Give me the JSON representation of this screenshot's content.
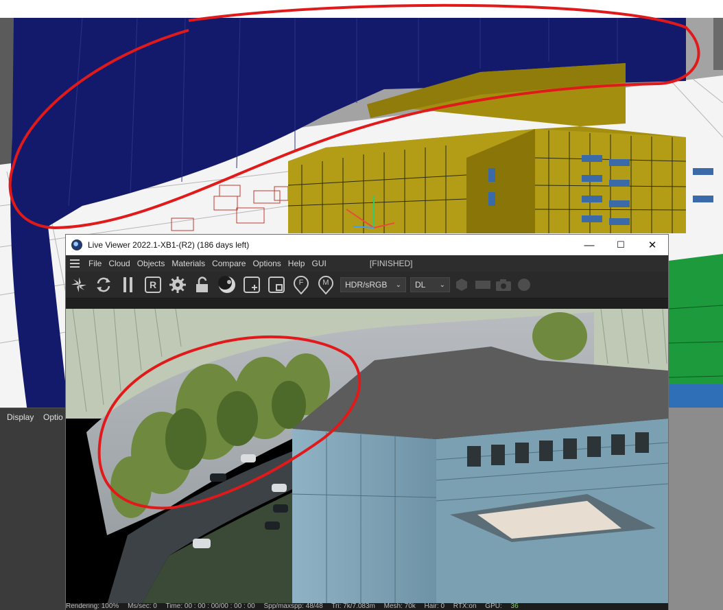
{
  "background_app": {
    "bottom_panel_tabs": [
      "Display",
      "Optio"
    ]
  },
  "live_viewer": {
    "title": "Live Viewer 2022.1-XB1-(R2) (186 days left)",
    "window_controls": {
      "minimize": "—",
      "maximize": "☐",
      "close": "✕"
    },
    "menu": [
      "File",
      "Cloud",
      "Objects",
      "Materials",
      "Compare",
      "Options",
      "Help",
      "GUI"
    ],
    "render_status": "[FINISHED]",
    "toolbar": {
      "icons": [
        "send-scene-icon",
        "restart-icon",
        "pause-icon",
        "region-render-icon",
        "settings-gear-icon",
        "lock-icon",
        "material-ball-icon",
        "add-region-icon",
        "clear-region-icon",
        "focus-pick-icon",
        "material-pick-icon"
      ],
      "letter_r": "R",
      "letter_f": "F",
      "letter_m": "M",
      "colorspace_select": "HDR/sRGB",
      "kernel_select": "DL"
    },
    "statusbar": {
      "rendering": "Rendering: 100%",
      "mssec": "Ms/sec: 0",
      "time": "Time: 00 : 00 : 00/00 : 00 : 00",
      "spp": "Spp/maxspp: 48/48",
      "tri": "Tri: 7k/7.083m",
      "mesh": "Mesh: 70k",
      "hair": "Hair: 0",
      "rtx": "RTX:on",
      "gpu": "GPU:",
      "gpu_value": "36"
    }
  },
  "colors": {
    "annotation": "#e01a1a",
    "dome_blue": "#12196a",
    "building_yellow": "#b09a14",
    "titlebar": "#ffffff",
    "ui_dark": "#2d2d2d"
  }
}
